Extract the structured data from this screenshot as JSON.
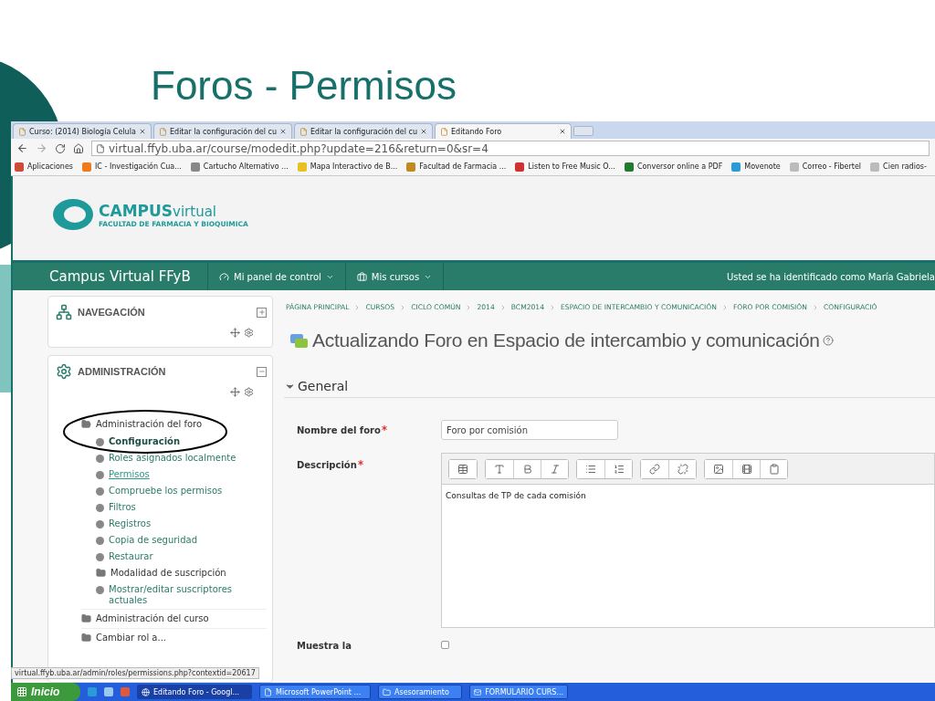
{
  "slide": {
    "title": "Foros - Permisos"
  },
  "browser": {
    "tabs": [
      {
        "label": "Curso: (2014) Biología Celula",
        "selected": false
      },
      {
        "label": "Editar la configuración del cu",
        "selected": false
      },
      {
        "label": "Editar la configuración del cu",
        "selected": false
      },
      {
        "label": "Editando Foro",
        "selected": true
      }
    ],
    "address": "virtual.ffyb.uba.ar/course/modedit.php?update=216&return=0&sr=4",
    "bookmarks": [
      {
        "label": "Aplicaciones",
        "color": "#d04a3a"
      },
      {
        "label": "IC - Investigación Cua...",
        "color": "#f07a1a"
      },
      {
        "label": "Cartucho Alternativo ...",
        "color": "#888888"
      },
      {
        "label": "Mapa Interactivo de B...",
        "color": "#e8c020"
      },
      {
        "label": "Facultad de Farmacia ...",
        "color": "#c08a20"
      },
      {
        "label": "Listen to Free Music O...",
        "color": "#d03030"
      },
      {
        "label": "Conversor online a PDF",
        "color": "#207a30"
      },
      {
        "label": "Movenote",
        "color": "#2a9ad8"
      },
      {
        "label": "Correo - Fibertel",
        "color": "#bbbbbb"
      },
      {
        "label": "Cien radios-",
        "color": "#bbbbbb"
      }
    ]
  },
  "site": {
    "logo": {
      "name": "CAMPUS",
      "suffix": "virtual",
      "subtitle": "FACULTAD DE FARMACIA Y BIOQUIMICA"
    },
    "navbar": {
      "brand": "Campus Virtual FFyB",
      "menus": [
        "Mi panel de control",
        "Mis cursos"
      ],
      "user_text": "Usted se ha identificado como María Gabriela"
    },
    "navigation_block": {
      "title": "NAVEGACIÓN",
      "expanded": false
    },
    "administration_block": {
      "title": "ADMINISTRACIÓN",
      "expanded": true,
      "tree": [
        {
          "label": "Administración del foro",
          "kind": "folder",
          "expanded": true,
          "children": [
            {
              "label": "Configuración",
              "kind": "leaf",
              "current": true,
              "hovered": false
            },
            {
              "label": "Roles asignados localmente",
              "kind": "leaf",
              "current": false,
              "hovered": false
            },
            {
              "label": "Permisos",
              "kind": "leaf",
              "current": false,
              "hovered": true
            },
            {
              "label": "Compruebe los permisos",
              "kind": "leaf",
              "current": false,
              "hovered": false
            },
            {
              "label": "Filtros",
              "kind": "leaf",
              "current": false,
              "hovered": false
            },
            {
              "label": "Registros",
              "kind": "leaf",
              "current": false,
              "hovered": false
            },
            {
              "label": "Copia de seguridad",
              "kind": "leaf",
              "current": false,
              "hovered": false
            },
            {
              "label": "Restaurar",
              "kind": "leaf",
              "current": false,
              "hovered": false
            },
            {
              "label": "Modalidad de suscripción",
              "kind": "folder",
              "current": false,
              "hovered": false
            },
            {
              "label": "Mostrar/editar suscriptores actuales",
              "kind": "leaf",
              "current": false,
              "hovered": false
            }
          ]
        },
        {
          "label": "Administración del curso",
          "kind": "folder",
          "expanded": false
        },
        {
          "label": "Cambiar rol a...",
          "kind": "folder",
          "expanded": false
        }
      ]
    },
    "breadcrumb": [
      "PÁGINA PRINCIPAL",
      "CURSOS",
      "CICLO COMÚN",
      "2014",
      "BCM2014",
      "ESPACIO DE INTERCAMBIO Y COMUNICACIÓN",
      "FORO POR COMISIÓN",
      "CONFIGURACIÓ"
    ],
    "heading": "Actualizando Foro en Espacio de intercambio y comunicación",
    "section": {
      "title": "General",
      "expanded": true,
      "fields": [
        {
          "label": "Nombre del foro",
          "required": true,
          "value": "Foro por comisión"
        },
        {
          "label": "Descripción",
          "required": true,
          "value": "Consultas de TP de cada comisión"
        }
      ],
      "checkbox": {
        "label": "Muestra la",
        "checked": false
      }
    }
  },
  "status_url": "virtual.ffyb.uba.ar/admin/roles/permissions.php?contextid=20617",
  "taskbar": {
    "start": "Inicio",
    "items": [
      {
        "label": "Editando Foro - Googl...",
        "selected": true
      },
      {
        "label": "Microsoft PowerPoint ...",
        "selected": false
      },
      {
        "label": "Asesoramiento",
        "selected": false
      },
      {
        "label": "FORMULARIO CURS...",
        "selected": false
      }
    ]
  }
}
